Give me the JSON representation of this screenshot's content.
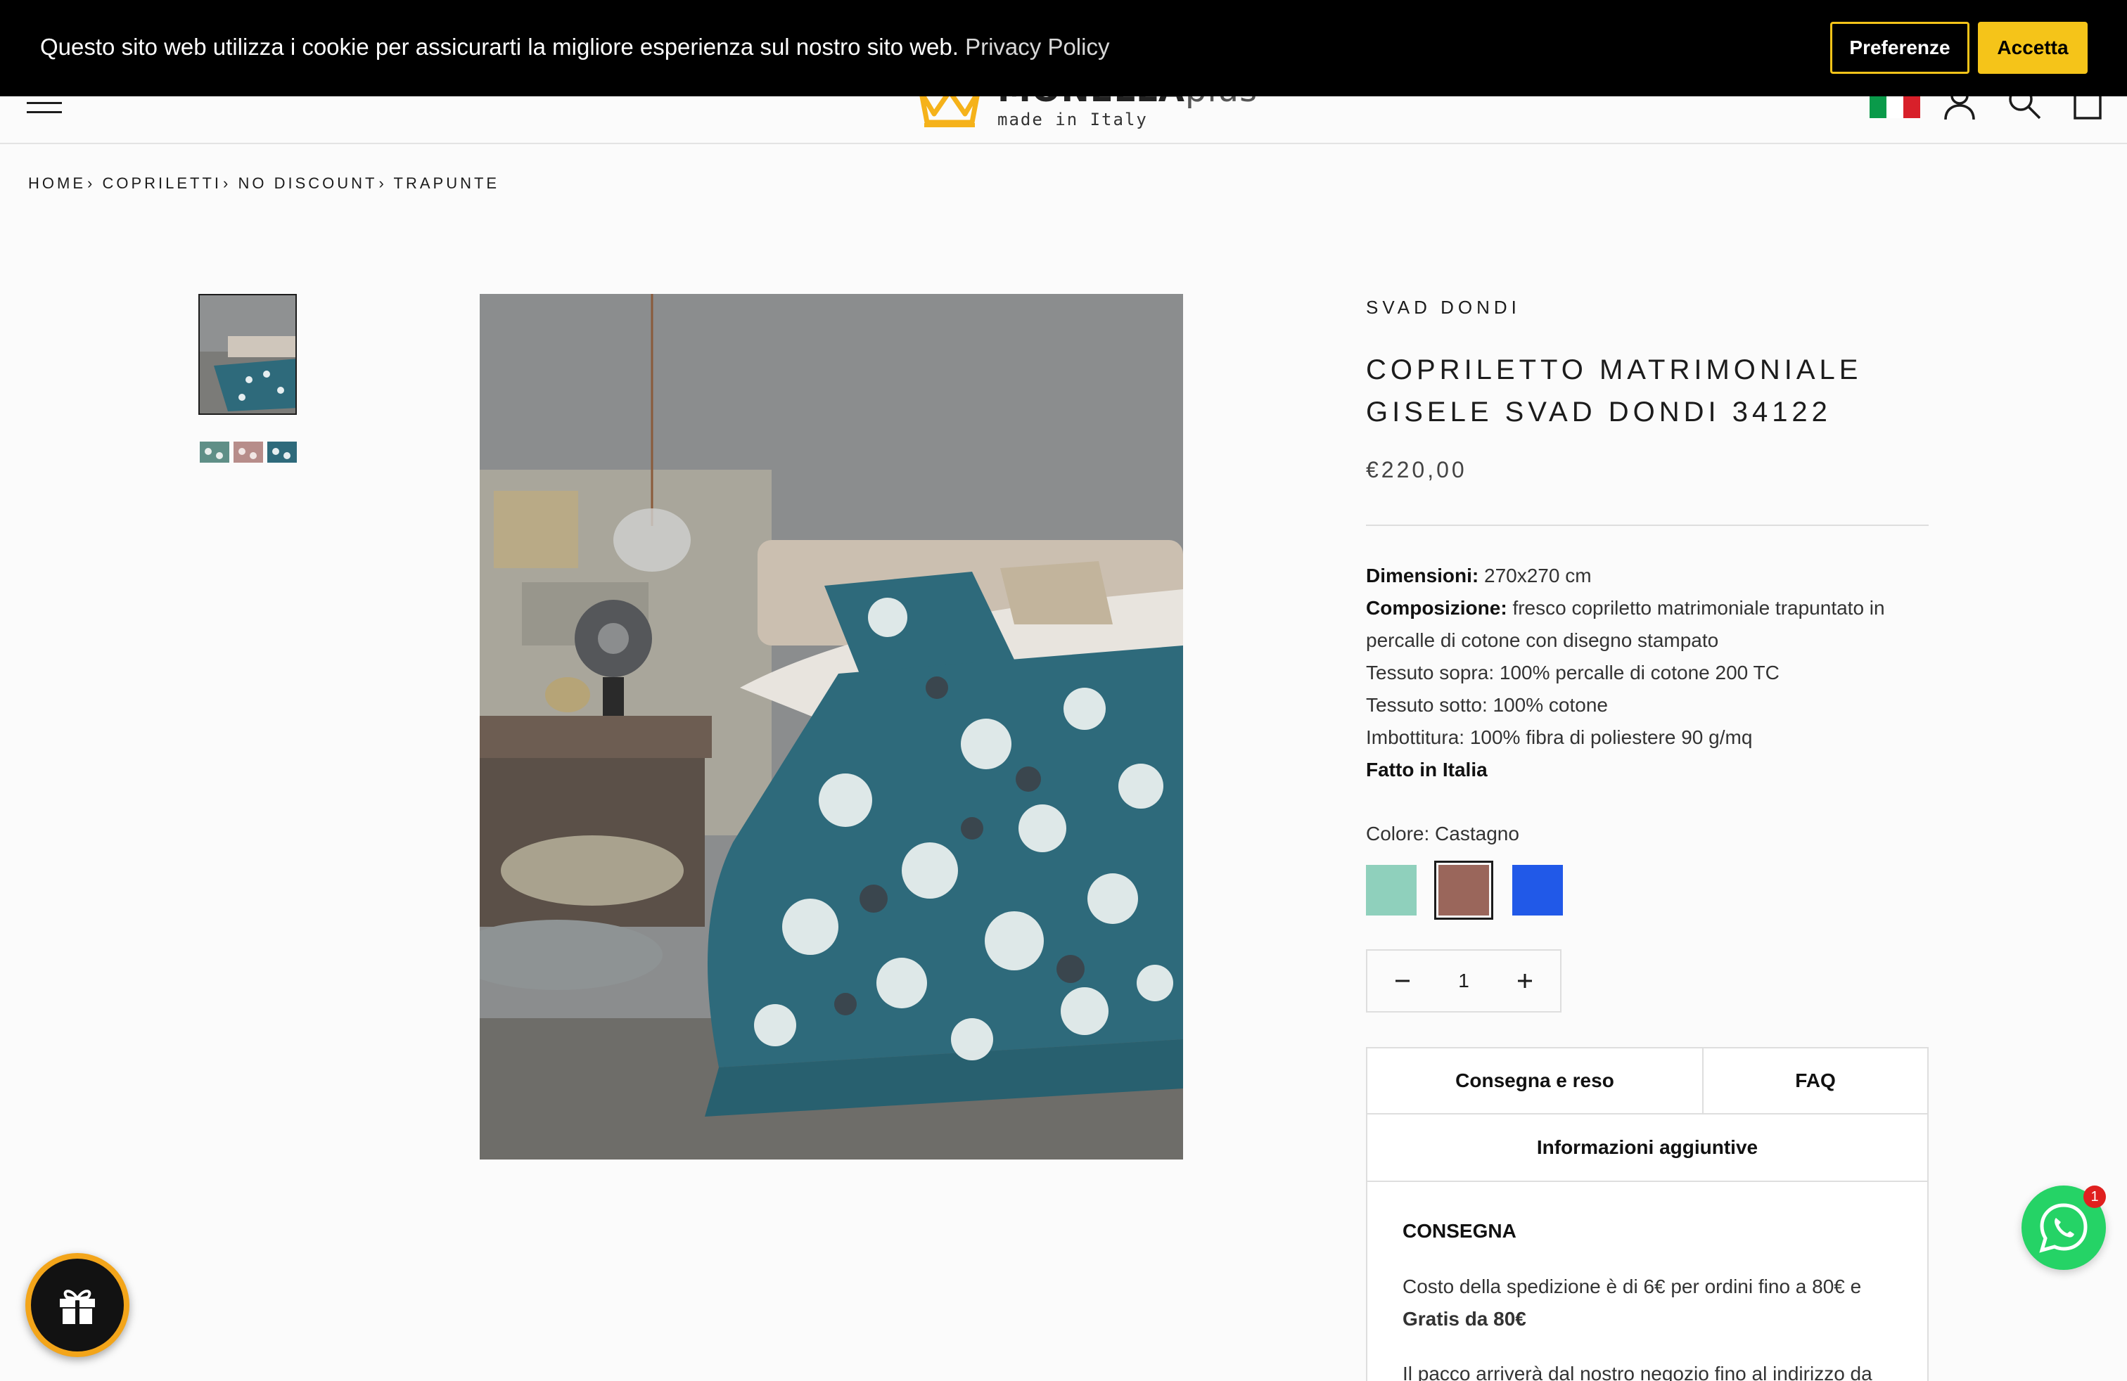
{
  "header": {
    "logo_text": "MONELLA",
    "logo_suffix": "plus",
    "logo_tagline": "made in Italy"
  },
  "cookie_banner": {
    "message": "Questo sito web utilizza i cookie per assicurarti la migliore esperienza sul nostro sito web.",
    "privacy_link": "Privacy Policy",
    "preferences_label": "Preferenze",
    "accept_label": "Accetta",
    "accent_color": "#f5c419"
  },
  "breadcrumb": [
    "HOME",
    "COPRILETTI",
    "NO DISCOUNT",
    "TRAPUNTE"
  ],
  "breadcrumb_sep": "›",
  "product": {
    "brand": "SVAD DONDI",
    "title": "COPRILETTO MATRIMONIALE GISELE SVAD DONDI 34122",
    "price": "€220,00",
    "description": [
      {
        "label": "Dimensioni:",
        "text": " 270x270 cm"
      },
      {
        "label": "Composizione:",
        "text": " fresco copriletto matrimoniale trapuntato in percalle di cotone con disegno stampato"
      },
      {
        "label": "",
        "text": "Tessuto sopra: 100% percalle di cotone 200 TC"
      },
      {
        "label": "",
        "text": "Tessuto sotto: 100% cotone"
      },
      {
        "label": "",
        "text": "Imbottitura: 100% fibra di poliestere 90 g/mq"
      },
      {
        "label": "Fatto in Italia",
        "text": ""
      }
    ],
    "color_label": "Colore:",
    "color_selected": "Castagno",
    "swatches": [
      "#8fd0bc",
      "#9a665b",
      "#2159e8"
    ],
    "quantity": "1"
  },
  "tabs": {
    "delivery": "Consegna e reso",
    "faq": "FAQ",
    "info": "Informazioni aggiuntive"
  },
  "delivery_panel": {
    "title": "CONSEGNA",
    "shipping_text": "Costo della spedizione è di 6€ per ordini fino a 80€ e",
    "shipping_free": "Gratis da 80€",
    "arrival_text": "Il pacco arriverà dal nostro negozio fino al indirizzo da"
  },
  "whatsapp": {
    "badge_count": "1"
  }
}
